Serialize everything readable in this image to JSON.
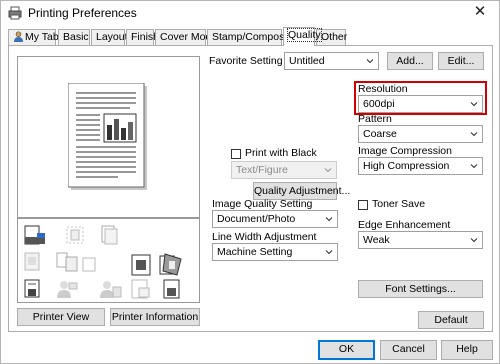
{
  "window": {
    "title": "Printing Preferences",
    "close_glyph": "✕"
  },
  "tabs": [
    {
      "label": "My Tab"
    },
    {
      "label": "Basic"
    },
    {
      "label": "Layout"
    },
    {
      "label": "Finish"
    },
    {
      "label": "Cover Mode"
    },
    {
      "label": "Stamp/Composition"
    },
    {
      "label": "Quality"
    },
    {
      "label": "Other"
    }
  ],
  "active_tab": "Quality",
  "favorite": {
    "label": "Favorite Setting",
    "value": "Untitled",
    "add_label": "Add...",
    "edit_label": "Edit..."
  },
  "left": {
    "printer_view_label": "Printer View",
    "printer_info_label": "Printer Information"
  },
  "middle": {
    "print_with_black_label": "Print with Black",
    "print_with_black_checked": false,
    "text_figure_value": "Text/Figure",
    "quality_adjustment_label": "Quality Adjustment...",
    "image_quality_label": "Image Quality Setting",
    "image_quality_value": "Document/Photo",
    "line_width_label": "Line Width Adjustment",
    "line_width_value": "Machine Setting"
  },
  "right": {
    "resolution_label": "Resolution",
    "resolution_value": "600dpi",
    "pattern_label": "Pattern",
    "pattern_value": "Coarse",
    "compression_label": "Image Compression",
    "compression_value": "High Compression",
    "toner_save_label": "Toner Save",
    "toner_save_checked": false,
    "edge_label": "Edge Enhancement",
    "edge_value": "Weak",
    "font_settings_label": "Font Settings...",
    "default_label": "Default"
  },
  "footer": {
    "ok_label": "OK",
    "cancel_label": "Cancel",
    "help_label": "Help"
  },
  "colors": {
    "highlight_border": "#d40000",
    "default_button_border": "#0078d7"
  }
}
